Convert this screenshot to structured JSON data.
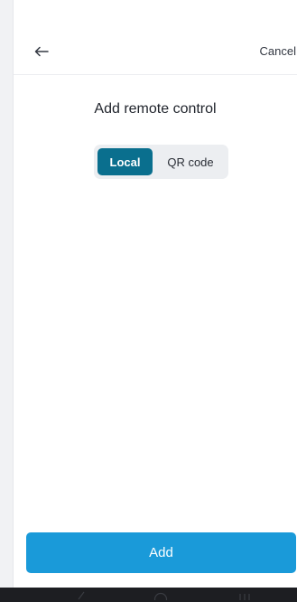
{
  "header": {
    "back_icon": "arrow-left-icon",
    "cancel_label": "Cancel"
  },
  "page": {
    "title": "Add remote control"
  },
  "segmented_control": {
    "options": [
      "Local",
      "QR code"
    ],
    "selected": "Local"
  },
  "footer": {
    "add_label": "Add"
  },
  "system_nav": {
    "icons": [
      "back-gesture-icon",
      "home-icon",
      "recents-icon"
    ]
  },
  "colors": {
    "accent_dark": "#0a6f8e",
    "accent_button": "#1a9ad9",
    "nav_bar": "#1d1e22"
  }
}
